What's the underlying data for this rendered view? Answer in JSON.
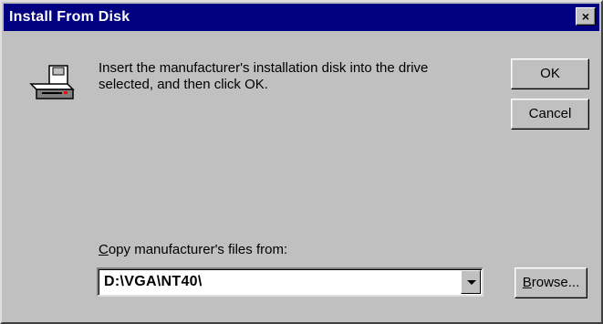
{
  "window": {
    "title": "Install From Disk",
    "close_glyph": "×"
  },
  "message": {
    "line1": "Insert the manufacturer's installation disk into the drive",
    "line2": "selected, and then click OK."
  },
  "buttons": {
    "ok_label": "OK",
    "cancel_label": "Cancel",
    "browse_label_u": "B",
    "browse_label_rest": "rowse..."
  },
  "copy_from": {
    "label_u": "C",
    "label_rest": "opy manufacturer's files from:",
    "value": "D:\\VGA\\NT40\\"
  },
  "icons": {
    "disk": "disk-drive-icon",
    "dropdown": "chevron-down-icon"
  }
}
